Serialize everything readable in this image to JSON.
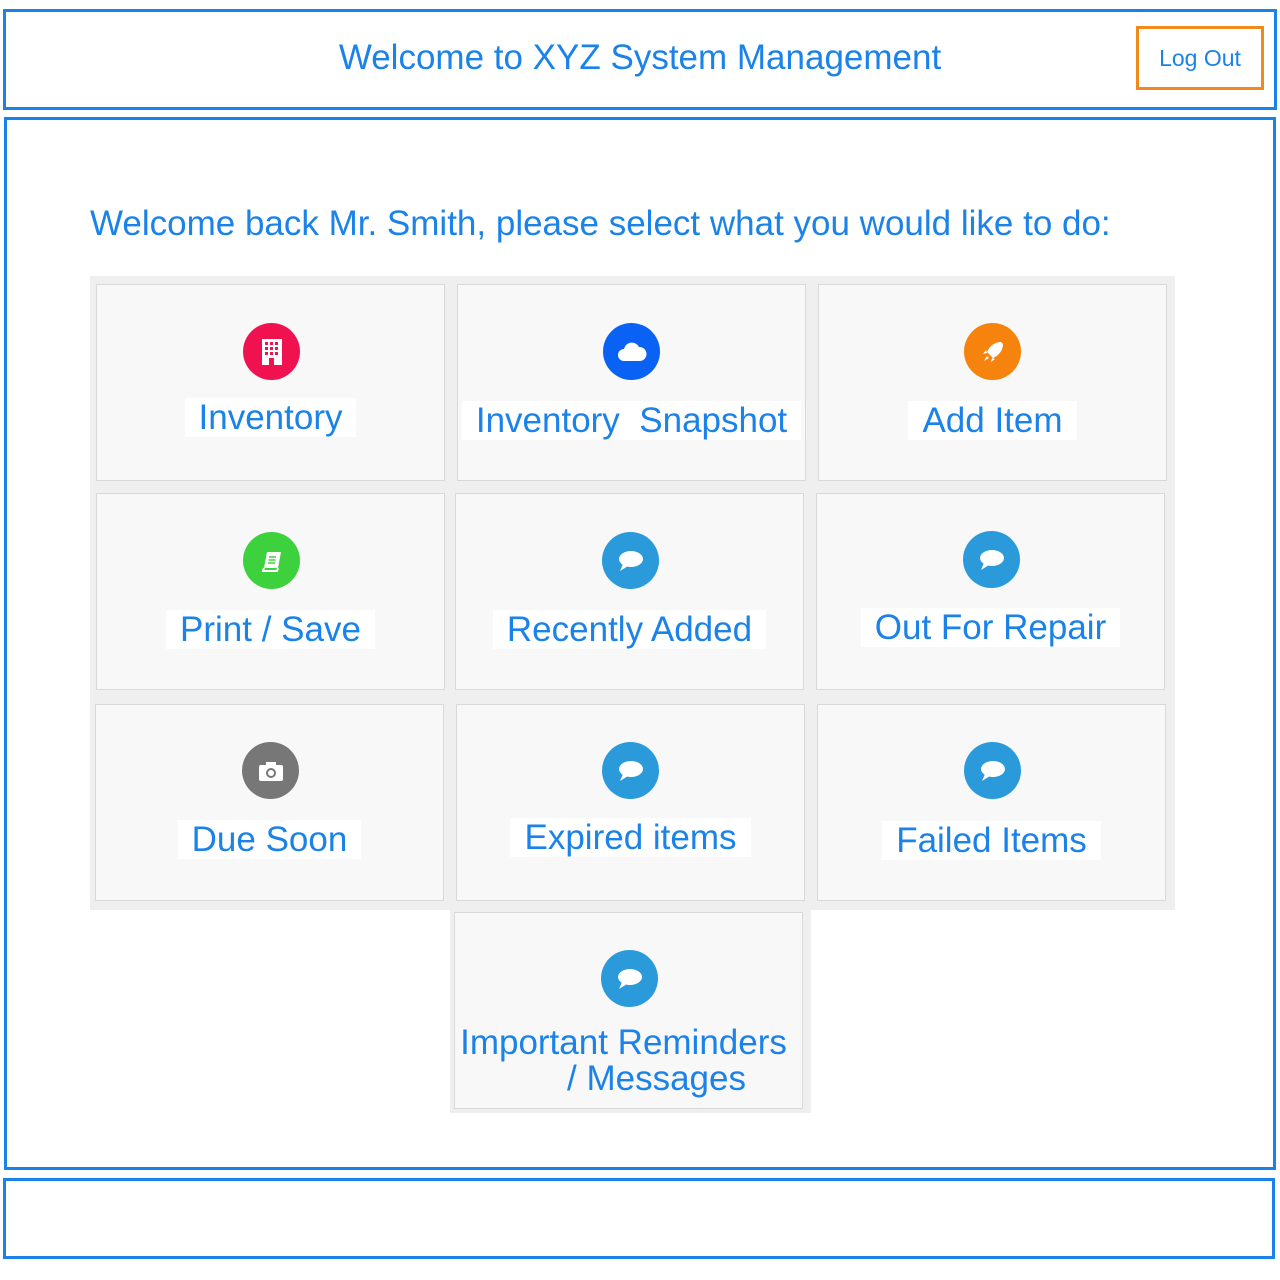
{
  "header": {
    "title": "Welcome to XYZ System Management",
    "logout_label": "Log Out"
  },
  "main": {
    "greeting": "Welcome back Mr. Smith, please select what you would like to do:",
    "tiles": [
      {
        "label": "Inventory",
        "icon": "building-icon",
        "color": "#f0124f"
      },
      {
        "label": "Inventory  Snapshot",
        "icon": "cloud-icon",
        "color": "#0a62f5"
      },
      {
        "label": "Add Item",
        "icon": "rocket-icon",
        "color": "#f5830e"
      },
      {
        "label": "Print / Save",
        "icon": "book-icon",
        "color": "#3ed13e"
      },
      {
        "label": "Recently Added",
        "icon": "chat-bubble-icon",
        "color": "#2a9adb"
      },
      {
        "label": "Out For Repair",
        "icon": "chat-bubble-icon",
        "color": "#2a9adb"
      },
      {
        "label": "Due Soon",
        "icon": "camera-icon",
        "color": "#777777"
      },
      {
        "label": "Expired items",
        "icon": "chat-bubble-icon",
        "color": "#2a9adb"
      },
      {
        "label": "Failed Items",
        "icon": "chat-bubble-icon",
        "color": "#2a9adb"
      },
      {
        "label_line1": "Important Reminders",
        "label_line2": "/ Messages",
        "icon": "chat-bubble-icon",
        "color": "#2a9adb"
      }
    ]
  },
  "colors": {
    "accent": "#1a82e8",
    "logout_border": "#f08a1c"
  }
}
